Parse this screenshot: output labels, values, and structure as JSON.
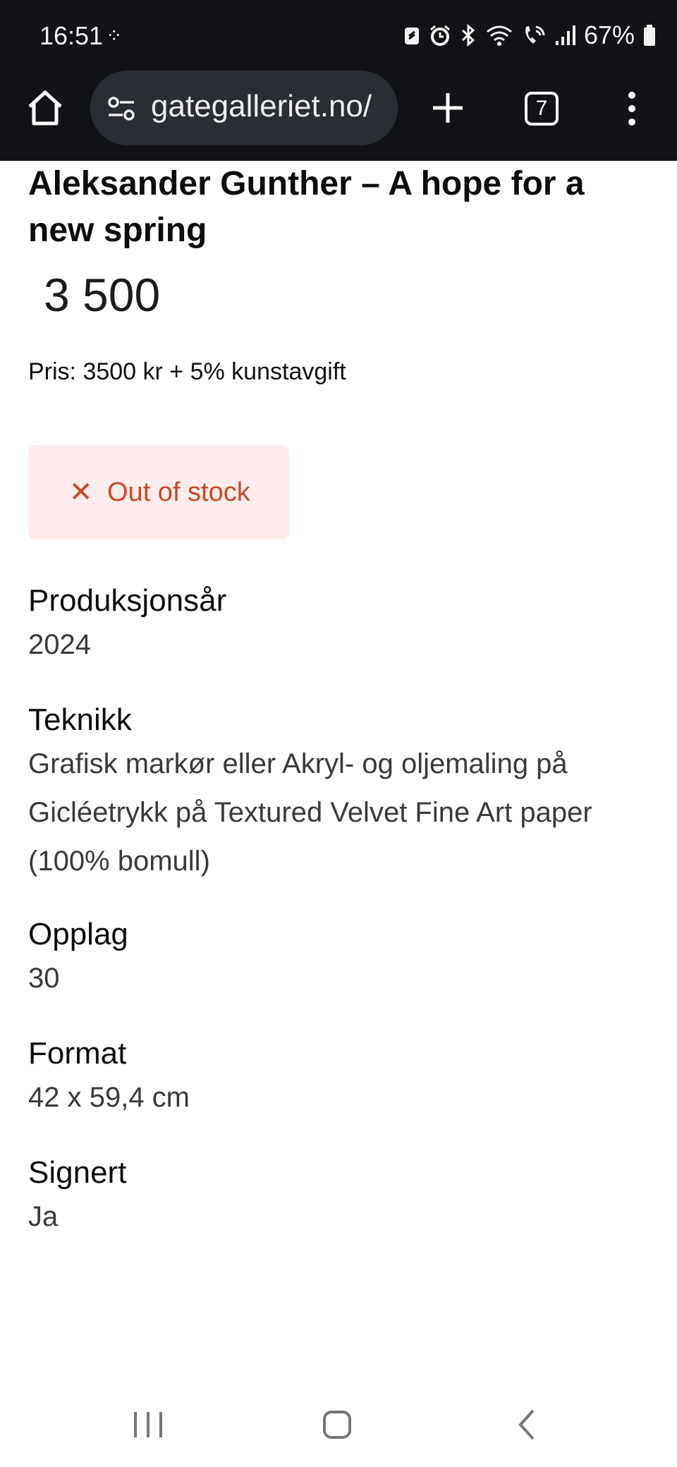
{
  "status_bar": {
    "time": "16:51",
    "battery_percent": "67%",
    "icons": [
      "sparkle-icon",
      "lock-badge-icon",
      "alarm-icon",
      "bluetooth-icon",
      "wifi-icon",
      "wifi-calling-icon",
      "signal-icon",
      "battery-icon"
    ]
  },
  "browser": {
    "url": "gategalleriet.no/",
    "tab_count": "7",
    "icons": [
      "home-icon",
      "tune-icon",
      "plus-icon",
      "tabs-icon",
      "more-vertical-icon"
    ]
  },
  "product": {
    "title": "Aleksander Gunther – A hope for a new spring",
    "price": "3 500",
    "price_note": "Pris: 3500 kr + 5% kunstavgift",
    "stock_status": "Out of stock",
    "stock_color": "#c9472b",
    "stock_bg": "#fdeceb"
  },
  "specs": [
    {
      "label": "Produksjonsår",
      "value": "2024"
    },
    {
      "label": "Teknikk",
      "value": "Grafisk markør eller Akryl- og oljemaling på Gicléetrykk på Textured Velvet Fine Art paper (100% bomull)"
    },
    {
      "label": "Opplag",
      "value": "30"
    },
    {
      "label": "Format",
      "value": "42 x 59,4 cm"
    },
    {
      "label": "Signert",
      "value": "Ja"
    }
  ],
  "nav_bar": {
    "icons": [
      "recent-apps-icon",
      "home-nav-icon",
      "back-icon"
    ]
  }
}
